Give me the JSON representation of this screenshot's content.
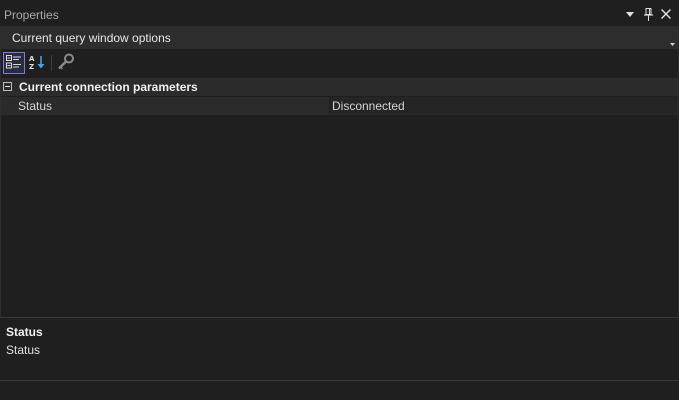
{
  "window": {
    "title": "Properties",
    "icons": [
      "dropdown-arrow-icon",
      "pin-icon",
      "close-icon"
    ]
  },
  "object_selector": {
    "selected": "Current query window options"
  },
  "toolbar": {
    "tools": [
      "categorized-icon",
      "alphabetical-icon",
      "property-pages-icon"
    ],
    "active_tool": "categorized-icon"
  },
  "grid": {
    "category": {
      "label": "Current connection parameters",
      "expanded": true
    },
    "properties": [
      {
        "name": "Status",
        "value": "Disconnected"
      }
    ]
  },
  "description": {
    "title": "Status",
    "text": "Status"
  },
  "colors": {
    "background": "#1f1f1f",
    "category_bg": "#2b2b2b",
    "active_tool_border": "#7a7adf",
    "sort_arrow": "#3fa3f0"
  }
}
